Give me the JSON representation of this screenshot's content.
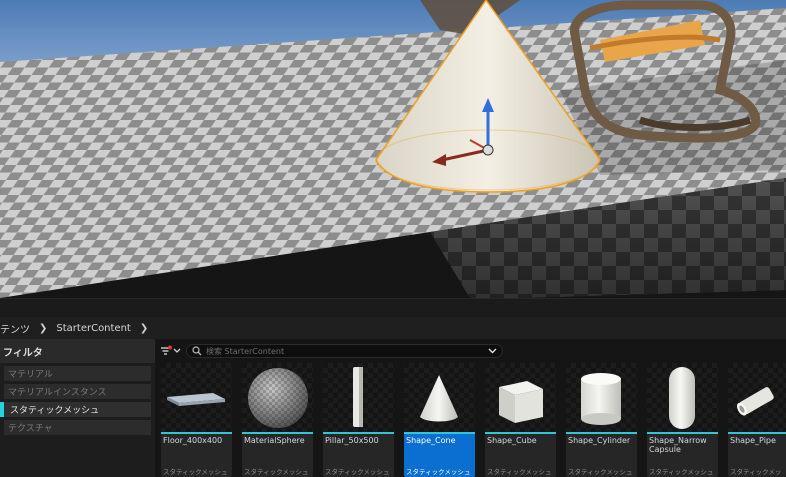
{
  "breadcrumb": {
    "items": [
      "テンツ",
      "StarterContent"
    ]
  },
  "filters": {
    "header": "フィルタ",
    "items": [
      {
        "label": "マテリアル",
        "active": false
      },
      {
        "label": "マテリアルインスタンス",
        "active": false
      },
      {
        "label": "スタティックメッシュ",
        "active": true
      },
      {
        "label": "テクスチャ",
        "active": false
      }
    ]
  },
  "search": {
    "placeholder": "検索 StarterContent",
    "value": ""
  },
  "assets": [
    {
      "name": "Floor_400x400",
      "type": "スタティックメッシュ",
      "selected": false,
      "icon": "floor-plane-icon"
    },
    {
      "name": "MaterialSphere",
      "type": "スタティックメッシュ",
      "selected": false,
      "icon": "sphere-icon"
    },
    {
      "name": "Pillar_50x500",
      "type": "スタティックメッシュ",
      "selected": false,
      "icon": "pillar-icon"
    },
    {
      "name": "Shape_Cone",
      "type": "スタティックメッシュ",
      "selected": true,
      "icon": "cone-icon"
    },
    {
      "name": "Shape_Cube",
      "type": "スタティックメッシュ",
      "selected": false,
      "icon": "cube-icon"
    },
    {
      "name": "Shape_Cylinder",
      "type": "スタティックメッシュ",
      "selected": false,
      "icon": "cylinder-icon"
    },
    {
      "name": "Shape_Narrow\nCapsule",
      "type": "スタティックメッシュ",
      "selected": false,
      "icon": "capsule-icon"
    },
    {
      "name": "Shape_Pipe",
      "type": "スタティックメッシュ",
      "selected": false,
      "icon": "pipe-icon"
    }
  ],
  "colors": {
    "accent_cyan": "#2fc7d6",
    "selection_blue": "#0a6fd1",
    "gizmo_z": "#2f6fe0",
    "gizmo_x": "#c0392b",
    "selection_outline": "#f0a020"
  }
}
